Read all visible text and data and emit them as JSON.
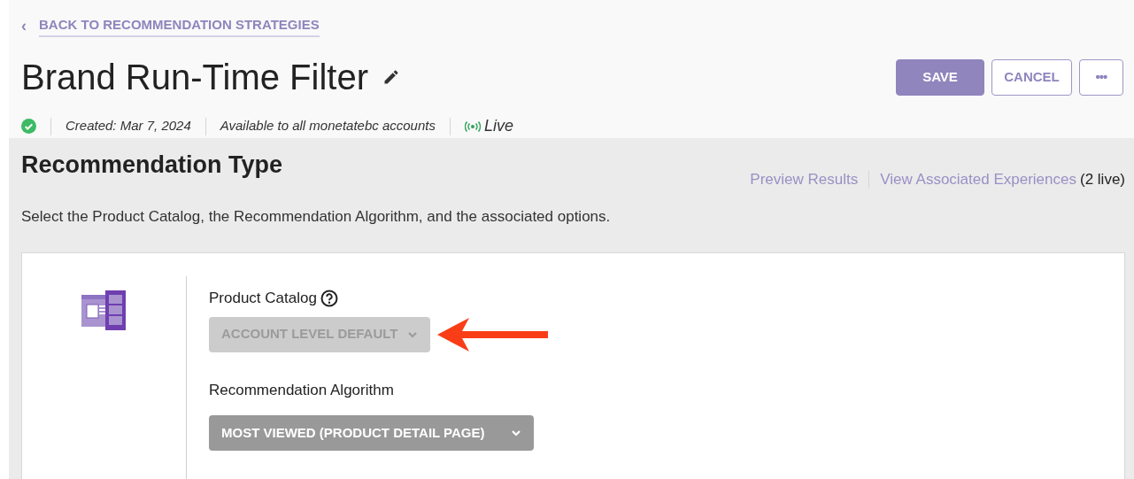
{
  "back_link": {
    "icon": "‹",
    "label": "BACK TO RECOMMENDATION STRATEGIES"
  },
  "header": {
    "title": "Brand Run-Time Filter",
    "status_ok": true,
    "created": "Created: Mar 7, 2024",
    "availability": "Available to all monetatebc accounts",
    "live": "Live"
  },
  "actions": [
    {
      "kind": "primary",
      "label": "SAVE"
    },
    {
      "kind": "outline",
      "label": "CANCEL"
    },
    {
      "kind": "more",
      "label": "•••"
    }
  ],
  "section": {
    "title": "Recommendation Type",
    "description": "Select the Product Catalog, the Recommendation Algorithm, and the associated options.",
    "links": [
      {
        "label": "Preview Results"
      },
      {
        "label": "View Associated Experiences",
        "suffix": "(2 live)"
      }
    ]
  },
  "fields": [
    {
      "label": "Product Catalog",
      "help_icon": true,
      "value": "ACCOUNT LEVEL DEFAULT",
      "disabled": true,
      "annotated": true
    },
    {
      "label": "Recommendation Algorithm",
      "help_icon": false,
      "value": "MOST VIEWED (PRODUCT DETAIL PAGE)",
      "disabled": false,
      "annotated": false
    }
  ]
}
